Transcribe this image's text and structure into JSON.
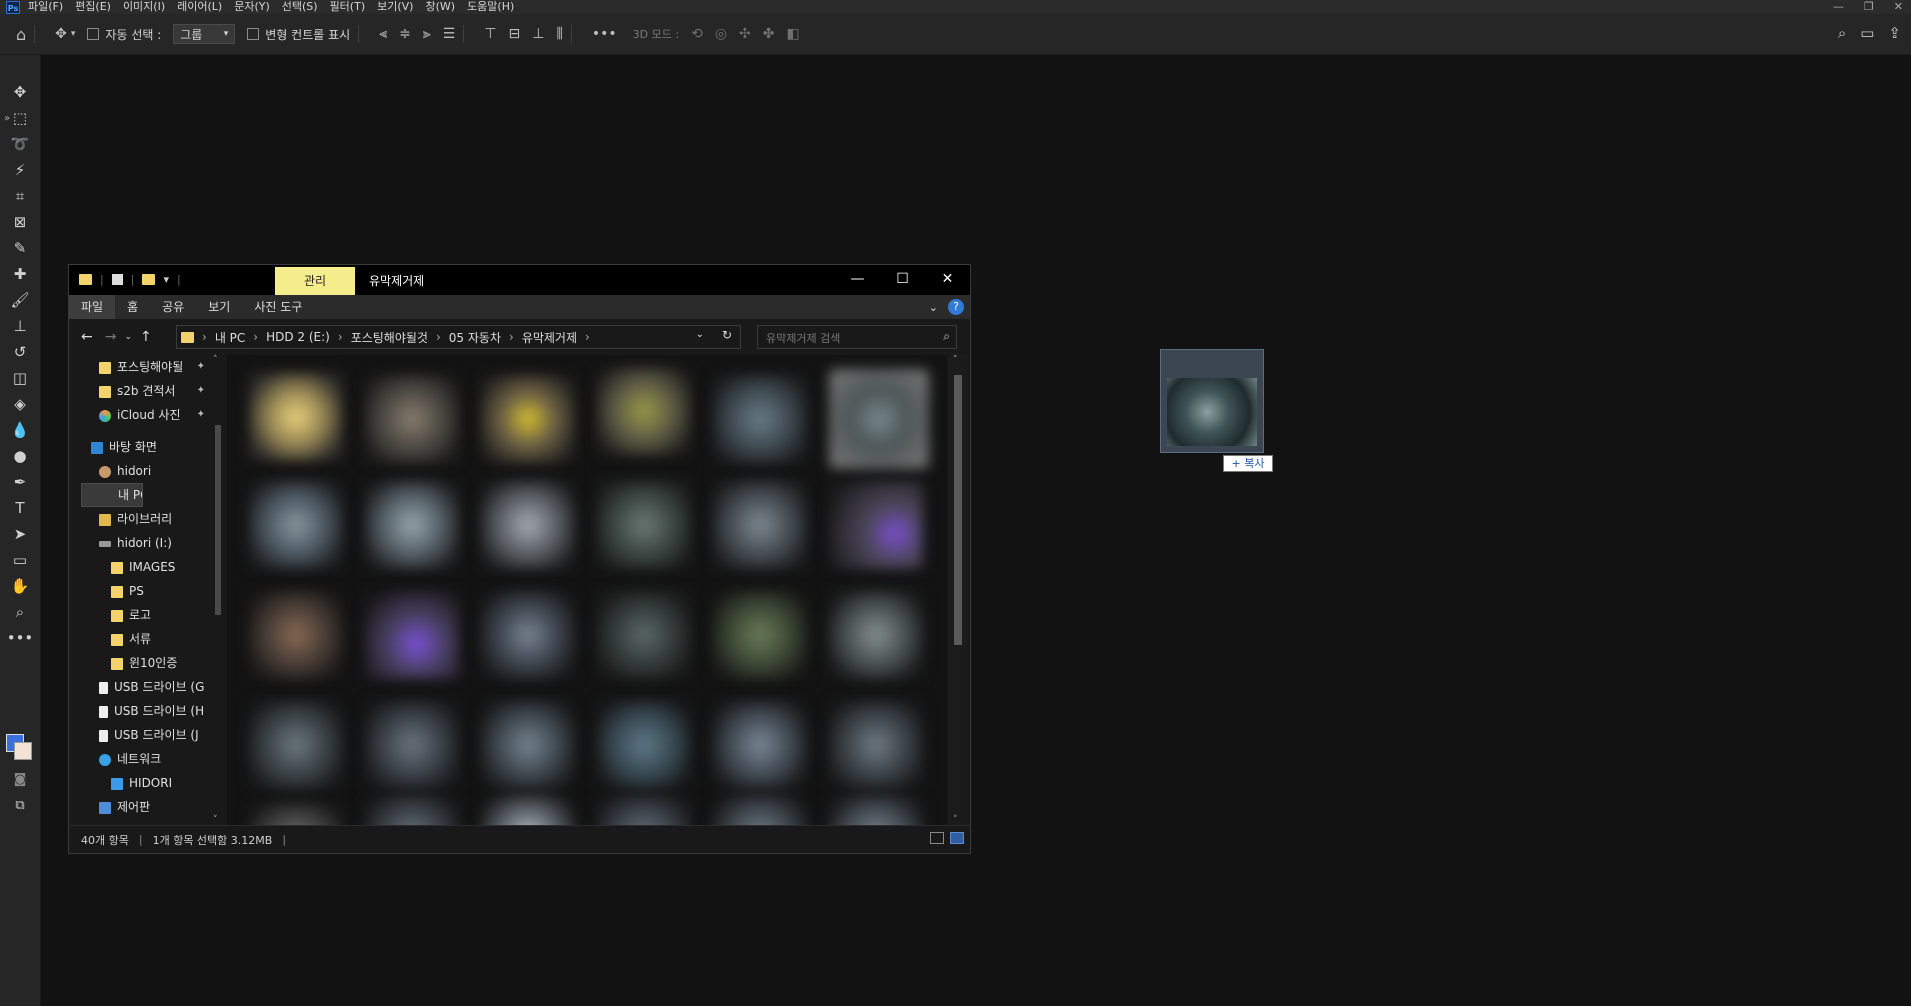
{
  "menu": {
    "logo": "Ps",
    "items": [
      "파일(F)",
      "편집(E)",
      "이미지(I)",
      "레이어(L)",
      "문자(Y)",
      "선택(S)",
      "필터(T)",
      "보기(V)",
      "창(W)",
      "도움말(H)"
    ]
  },
  "options_bar": {
    "auto_select_label": "자동 선택 :",
    "auto_select_value": "그룹",
    "transform_controls_label": "변형 컨트롤 표시",
    "mode_3d_label": "3D 모드 :"
  },
  "explorer": {
    "manage_tab": "관리",
    "window_title": "유막제거제",
    "ribbon_tabs": [
      "파일",
      "홈",
      "공유",
      "보기",
      "사진 도구"
    ],
    "breadcrumb": [
      "내 PC",
      "HDD 2 (E:)",
      "포스팅해야될것",
      "05 자동차",
      "유막제거제"
    ],
    "search_placeholder": "유막제거제 검색",
    "nav_items": [
      {
        "label": "포스팅해야될",
        "icon": "folder",
        "pinned": true
      },
      {
        "label": "s2b 견적서",
        "icon": "folder",
        "pinned": true
      },
      {
        "label": "iCloud 사진",
        "icon": "icloud",
        "pinned": true
      },
      {
        "label": "바탕 화면",
        "icon": "desktop",
        "pinned": false
      },
      {
        "label": "hidori",
        "icon": "user",
        "pinned": false
      },
      {
        "label": "내 PC",
        "icon": "pc",
        "pinned": false,
        "selected": true
      },
      {
        "label": "라이브러리",
        "icon": "library",
        "pinned": false
      },
      {
        "label": "hidori (I:)",
        "icon": "drive",
        "pinned": false
      },
      {
        "label": "IMAGES",
        "icon": "folder",
        "pinned": false
      },
      {
        "label": "PS",
        "icon": "folder",
        "pinned": false
      },
      {
        "label": "로고",
        "icon": "folder",
        "pinned": false
      },
      {
        "label": "서류",
        "icon": "folder",
        "pinned": false
      },
      {
        "label": "윈10인증",
        "icon": "folder",
        "pinned": false
      },
      {
        "label": "USB 드라이브 (G",
        "icon": "usb",
        "pinned": false
      },
      {
        "label": "USB 드라이브 (H",
        "icon": "usb",
        "pinned": false
      },
      {
        "label": "USB 드라이브 (J",
        "icon": "usb",
        "pinned": false
      },
      {
        "label": "네트워크",
        "icon": "network",
        "pinned": false
      },
      {
        "label": "HIDORI",
        "icon": "pc",
        "pinned": false
      },
      {
        "label": "제어판",
        "icon": "control",
        "pinned": false
      }
    ],
    "status": {
      "count": "40개 항목",
      "selection": "1개 항목 선택함 3.12MB"
    }
  },
  "drag": {
    "label": "+ 복사"
  },
  "colors": {
    "accent_blue": "#3a6fe0",
    "manage_tab": "#f5ed8c",
    "folder": "#f3d36b"
  }
}
